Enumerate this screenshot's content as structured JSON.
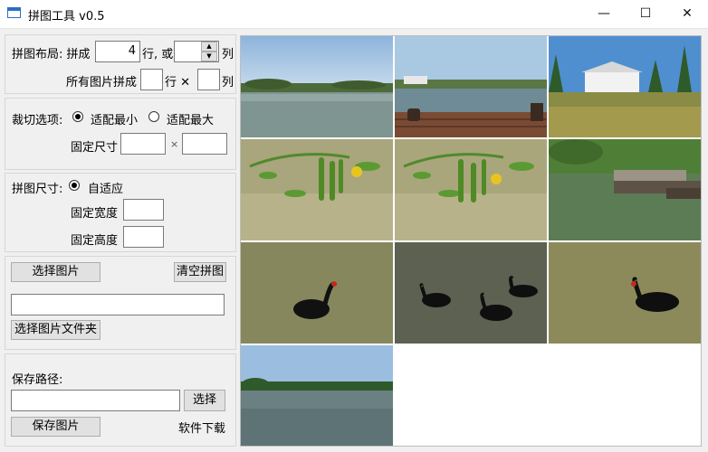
{
  "window": {
    "title": "拼图工具 v0.5",
    "minimize": "—",
    "maximize": "☐",
    "close": "✕"
  },
  "layout_group": {
    "label_prefix": "拼图布局: 拼成",
    "rows_value": "4",
    "rows_suffix": "行, 或",
    "cols_value": "",
    "cols_suffix": "列",
    "all_label": "所有图片拼成",
    "all_rows_value": "",
    "all_rows_suffix": "行 ✕",
    "all_cols_value": "",
    "all_cols_suffix": "列"
  },
  "crop_group": {
    "label": "裁切选项:",
    "option_min": "适配最小",
    "option_max": "适配最大",
    "selected": "适配最小",
    "fixed_size_label": "固定尺寸",
    "fixed_w_value": "",
    "times": "×",
    "fixed_h_value": ""
  },
  "size_group": {
    "label": "拼图尺寸:",
    "option_auto": "自适应",
    "fixed_width_label": "固定宽度",
    "fixed_width_value": "",
    "fixed_height_label": "固定高度",
    "fixed_height_value": ""
  },
  "images_group": {
    "select_images": "选择图片",
    "clear": "清空拼图",
    "folder_path_value": "",
    "select_folder": "选择图片文件夹"
  },
  "save_group": {
    "path_label": "保存路径:",
    "path_value": "",
    "choose": "选择",
    "save": "保存图片",
    "download": "软件下载"
  },
  "mosaic": {
    "tiles": [
      {
        "scene": "lake-trees"
      },
      {
        "scene": "boardwalk-lake"
      },
      {
        "scene": "white-house-reeds"
      },
      {
        "scene": "green-pods"
      },
      {
        "scene": "green-pods"
      },
      {
        "scene": "boats-dock"
      },
      {
        "scene": "black-swan"
      },
      {
        "scene": "two-black-swans"
      },
      {
        "scene": "black-swan"
      },
      {
        "scene": "lake-trees"
      }
    ]
  },
  "colors": {
    "accent": "#2b6fc4",
    "button_bg": "#e1e1e1",
    "panel_bg": "#f0f0f0"
  }
}
